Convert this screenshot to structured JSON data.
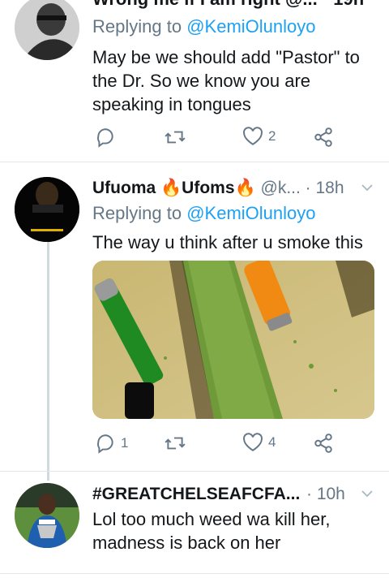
{
  "tweets": [
    {
      "header_clipped": "Wrong me if I am right @...  · 19h",
      "replying_prefix": "Replying to",
      "replying_handle": "@KemiOlunloyo",
      "text": "May be we should add \"Pastor\" to the Dr. So we know you are speaking in tongues",
      "reply_count": "",
      "retweet_count": "",
      "like_count": "2"
    },
    {
      "name_part1": "Ufuoma ",
      "flame1": "🔥",
      "name_part2": "Ufoms",
      "flame2": "🔥",
      "handle": "@k...",
      "time": "· 18h",
      "replying_prefix": "Replying to",
      "replying_handle": "@KemiOlunloyo",
      "text": "The way u think after u smoke this",
      "reply_count": "1",
      "retweet_count": "",
      "like_count": "4"
    },
    {
      "name": "#GREATCHELSEAFCFA...",
      "time": "· 10h",
      "text": "Lol too much weed wa kill her, madness is back on her"
    }
  ],
  "colors": {
    "link": "#1da1f2",
    "secondary": "#657786",
    "divider": "#e1e8ed"
  },
  "icons": [
    "reply-icon",
    "retweet-icon",
    "like-icon",
    "share-icon",
    "chevron-down-icon"
  ]
}
